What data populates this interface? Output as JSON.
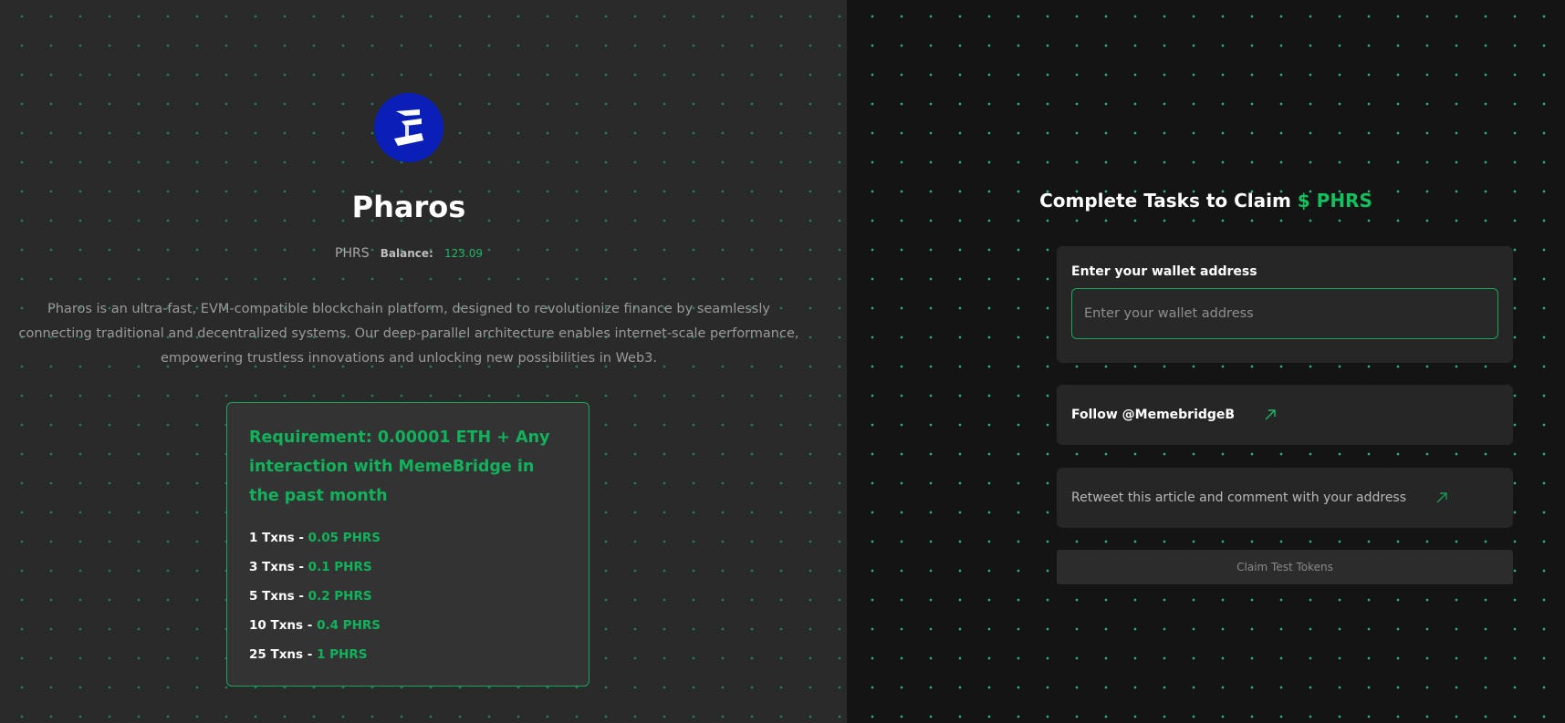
{
  "project": {
    "name": "Pharos",
    "symbol": "PHRS",
    "balance_label": "Balance:",
    "balance_value": "123.09",
    "description": "Pharos is an ultra-fast, EVM-compatible blockchain platform, designed to revolutionize finance by seamlessly connecting traditional and decentralized systems. Our deep-parallel architecture enables internet-scale performance, empowering trustless innovations and unlocking new possibilities in Web3.",
    "logo_icon": "pharos-logo-icon"
  },
  "requirement": {
    "title": "Requirement: 0.00001 ETH + Any interaction with MemeBridge in the past month",
    "tiers": [
      {
        "txns": "1 Txns - ",
        "reward": "0.05 PHRS"
      },
      {
        "txns": "3 Txns - ",
        "reward": "0.1 PHRS"
      },
      {
        "txns": "5 Txns - ",
        "reward": "0.2 PHRS"
      },
      {
        "txns": "10 Txns - ",
        "reward": "0.4 PHRS"
      },
      {
        "txns": "25 Txns - ",
        "reward": "1 PHRS"
      }
    ]
  },
  "tasks": {
    "heading_prefix": "Complete Tasks to Claim ",
    "heading_accent": "$ PHRS",
    "wallet_label": "Enter your wallet address",
    "wallet_placeholder": "Enter your wallet address",
    "wallet_value": "",
    "follow_label": "Follow @MemebridgeB",
    "retweet_label": "Retweet this article and comment with your address",
    "claim_button": "Claim Test Tokens",
    "arrow_icon": "external-link-arrow-icon"
  },
  "colors": {
    "accent_green": "#12b25c",
    "left_background": "#2a2a2a",
    "right_background": "#141414",
    "logo_blue": "#0a1fb8"
  }
}
